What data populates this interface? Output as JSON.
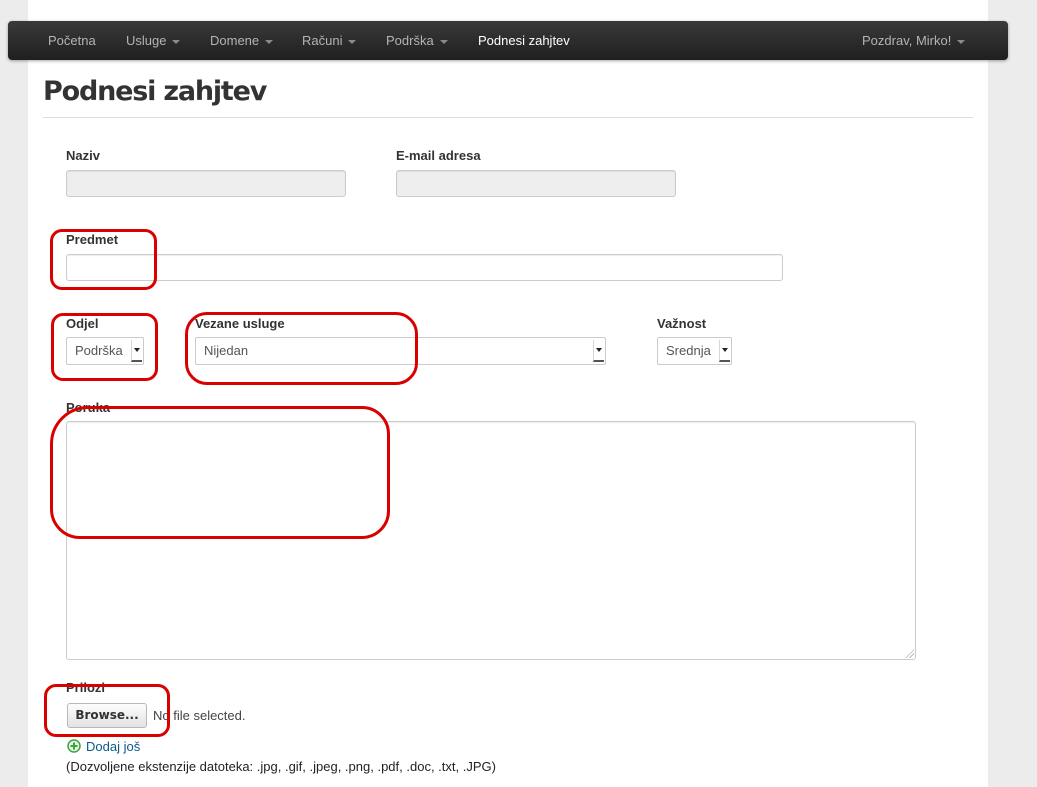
{
  "navbar": {
    "items": [
      {
        "label": "Početna",
        "dropdown": false,
        "active": false
      },
      {
        "label": "Usluge",
        "dropdown": true,
        "active": false
      },
      {
        "label": "Domene",
        "dropdown": true,
        "active": false
      },
      {
        "label": "Računi",
        "dropdown": true,
        "active": false
      },
      {
        "label": "Podrška",
        "dropdown": true,
        "active": false
      },
      {
        "label": "Podnesi zahjtev",
        "dropdown": false,
        "active": true
      }
    ],
    "user_menu": "Pozdrav, Mirko!"
  },
  "page": {
    "title": "Podnesi zahjtev"
  },
  "form": {
    "name": {
      "label": "Naziv",
      "value": ""
    },
    "email": {
      "label": "E-mail adresa",
      "value": ""
    },
    "subject": {
      "label": "Predmet",
      "value": ""
    },
    "department": {
      "label": "Odjel",
      "selected": "Podrška"
    },
    "related_service": {
      "label": "Vezane usluge",
      "selected": "Nijedan"
    },
    "priority": {
      "label": "Važnost",
      "selected": "Srednja"
    },
    "message": {
      "label": "Poruka",
      "value": ""
    },
    "attachments": {
      "label": "Prilozi",
      "browse_label": "Browse...",
      "file_status": "No file selected.",
      "add_more_label": "Dodaj još",
      "allowed_extensions_note": "(Dozvoljene ekstenzije datoteka: .jpg, .gif, .jpeg, .png, .pdf, .doc, .txt, .JPG)"
    }
  },
  "colors": {
    "navbar_bg": "#2c2c2c",
    "annotation": "#d90000",
    "link": "#0a5a8a",
    "add_icon": "#3aa63a"
  }
}
